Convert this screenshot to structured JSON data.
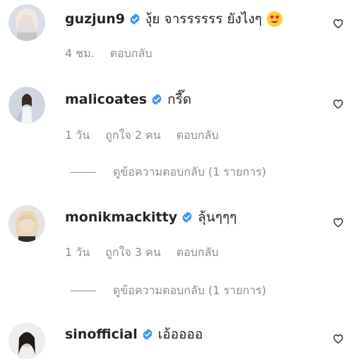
{
  "comments": [
    {
      "username": "guzjun9",
      "verified": true,
      "text": "งุ้ย จารรรรรร ยังไงๆ",
      "emoji": "heart-eyes-emoji",
      "meta": {
        "time": "4 ชม.",
        "likes": "",
        "reply": "ตอบกลับ"
      },
      "view_replies": ""
    },
    {
      "username": "malicoates",
      "verified": true,
      "text": "กรี๊ด",
      "meta": {
        "time": "1 วัน",
        "likes": "ถูกใจ 2 คน",
        "reply": "ตอบกลับ"
      },
      "view_replies": "ดูข้อความตอบกลับ (1 รายการ)"
    },
    {
      "username": "monikmackitty",
      "verified": true,
      "text": "ลุ้นๆๆๆ",
      "meta": {
        "time": "1 วัน",
        "likes": "ถูกใจ 3 คน",
        "reply": "ตอบกลับ"
      },
      "view_replies": "ดูข้อความตอบกลับ (1 รายการ)"
    },
    {
      "username": "sinofficial",
      "verified": true,
      "text": "เอ้ออออ"
    }
  ],
  "icons": {
    "verified": "verified-badge-icon",
    "like": "heart-outline-icon"
  },
  "colors": {
    "verified": "#3897f0",
    "secondary_text": "#8e8e8e",
    "primary_text": "#262626"
  }
}
